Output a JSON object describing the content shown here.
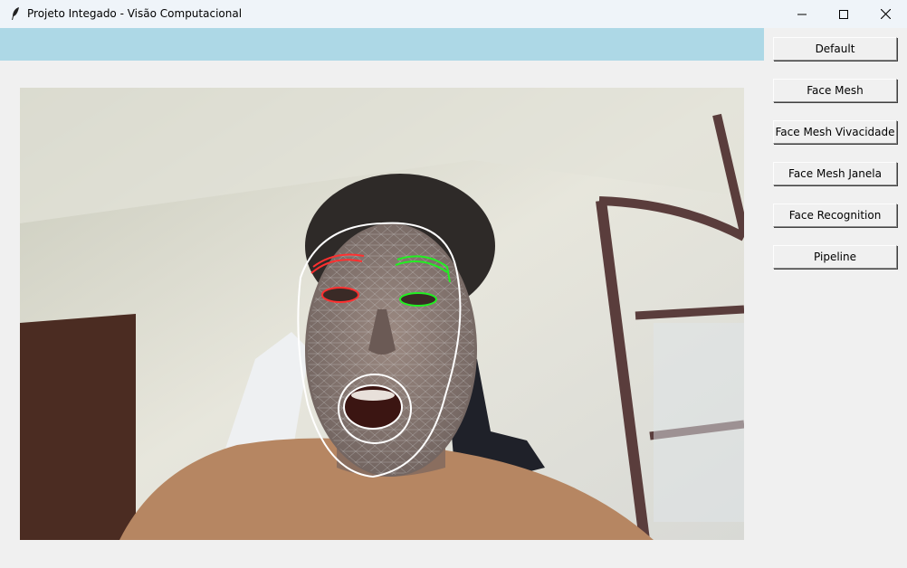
{
  "window": {
    "title": "Projeto Integado - Visão Computacional",
    "controls": [
      "minimize-icon",
      "maximize-icon",
      "close-icon"
    ]
  },
  "status_bar": {
    "text": "",
    "color": "#add8e6"
  },
  "sidebar": {
    "buttons": [
      {
        "label": "Default"
      },
      {
        "label": "Face Mesh"
      },
      {
        "label": "Face Mesh Vivacidade"
      },
      {
        "label": "Face Mesh Janela"
      },
      {
        "label": "Face Recognition"
      },
      {
        "label": "Pipeline"
      }
    ]
  },
  "overlay": {
    "face_oval_color": "#ffffff",
    "right_side_color": "#ff3030",
    "left_side_color": "#22ee22"
  }
}
